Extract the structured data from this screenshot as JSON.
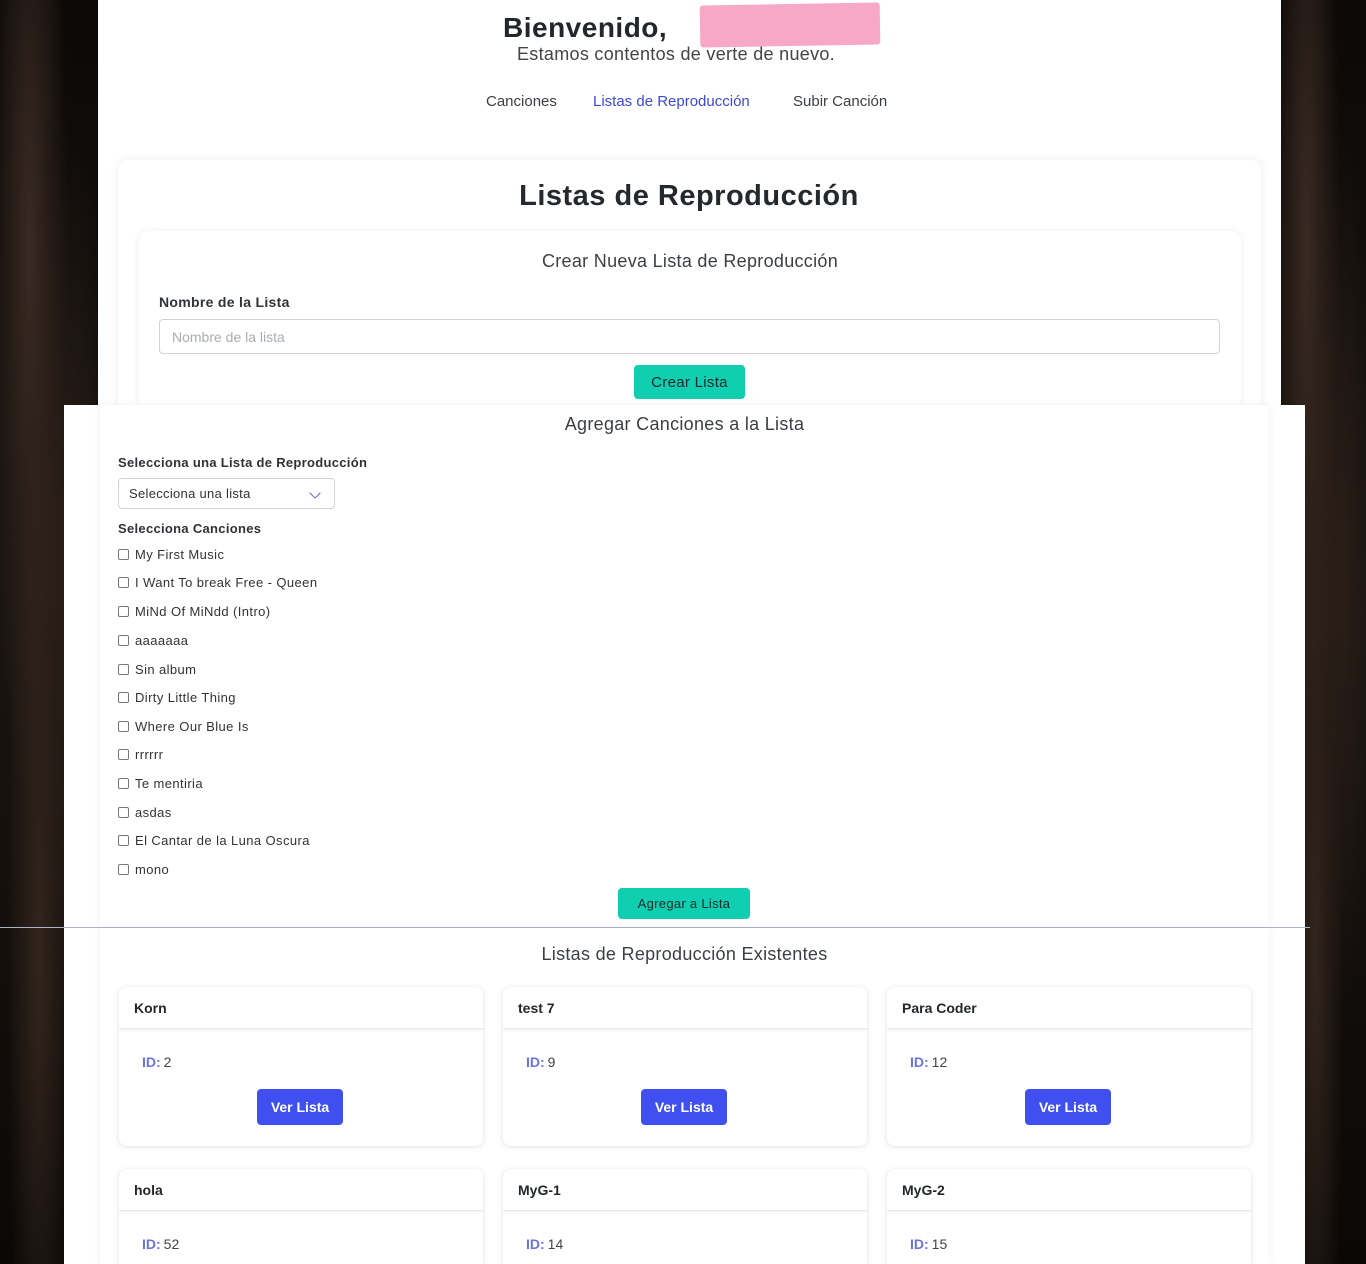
{
  "header": {
    "welcome": "Bienvenido,",
    "subtitle": "Estamos contentos de verte de nuevo."
  },
  "nav": {
    "items": [
      {
        "label": "Canciones"
      },
      {
        "label": "Listas de Reproducción",
        "active": true
      },
      {
        "label": "Subir Canción"
      }
    ]
  },
  "main": {
    "title": "Listas de Reproducción",
    "create": {
      "title": "Crear Nueva Lista de Reproducción",
      "name_label": "Nombre de la Lista",
      "name_placeholder": "Nombre de la lista",
      "name_value": "",
      "button": "Crear Lista"
    },
    "add": {
      "title": "Agregar Canciones a la Lista",
      "select_label": "Selecciona una Lista de Reproducción",
      "select_value": "Selecciona una lista",
      "songs_label": "Selecciona Canciones",
      "songs": [
        "My First Music",
        "I Want To break Free - Queen",
        "MiNd Of MiNdd (Intro)",
        "aaaaaaa",
        "Sin album",
        "Dirty Little Thing",
        "Where Our Blue Is",
        "rrrrrr",
        "Te mentiria",
        "asdas",
        "El Cantar de la Luna Oscura",
        "mono"
      ],
      "button": "Agregar a Lista"
    },
    "existing": {
      "title": "Listas de Reproducción Existentes",
      "id_key": "ID:",
      "view_button": "Ver Lista",
      "playlists": [
        {
          "name": "Korn",
          "id": "2"
        },
        {
          "name": "test 7",
          "id": "9"
        },
        {
          "name": "Para Coder",
          "id": "12"
        },
        {
          "name": "hola",
          "id": "52"
        },
        {
          "name": "MyG-1",
          "id": "14"
        },
        {
          "name": "MyG-2",
          "id": "15"
        }
      ]
    }
  },
  "colors": {
    "accent_blue": "#3f4ff0",
    "teal_button": "#0fcfb0",
    "active_nav": "#3d49d6",
    "redaction": "#f7a8c6"
  }
}
